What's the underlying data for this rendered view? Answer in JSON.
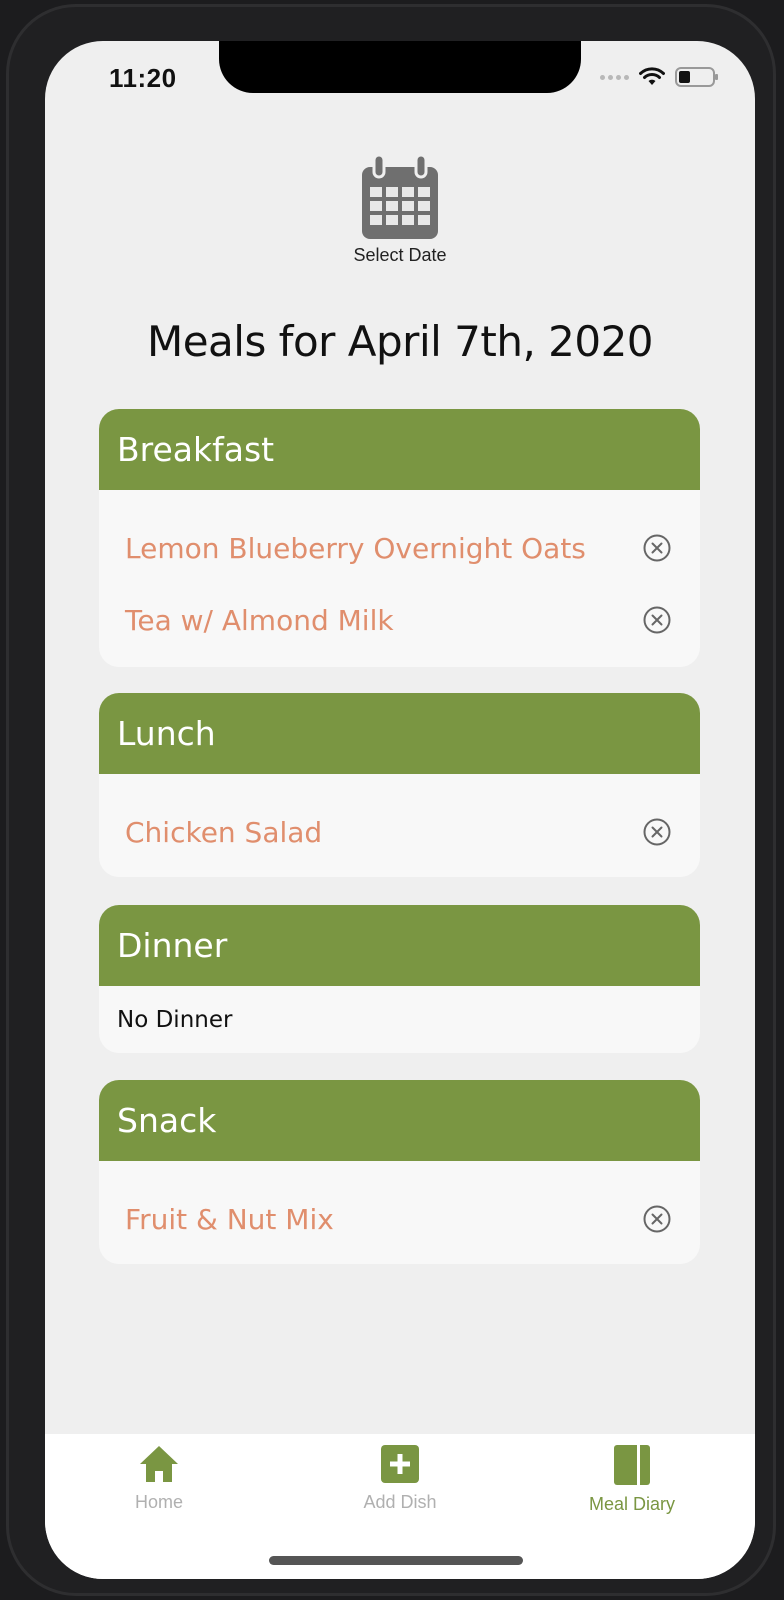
{
  "colors": {
    "accent": "#7a9642",
    "dish_text": "#e08e6d",
    "tab_inactive": "#b0b0b0",
    "tab_active": "#7a9642"
  },
  "status_bar": {
    "time": "11:20"
  },
  "date_picker": {
    "icon": "calendar-icon",
    "label": "Select Date"
  },
  "page_title": "Meals for April 7th, 2020",
  "meals": [
    {
      "title": "Breakfast",
      "dishes": [
        "Lemon Blueberry Overnight Oats",
        "Tea w/ Almond Milk"
      ]
    },
    {
      "title": "Lunch",
      "dishes": [
        "Chicken Salad"
      ]
    },
    {
      "title": "Dinner",
      "empty_text": "No Dinner"
    },
    {
      "title": "Snack",
      "dishes": [
        "Fruit & Nut Mix"
      ]
    }
  ],
  "tab_bar": {
    "tabs": [
      {
        "label": "Home",
        "icon": "home-icon",
        "active": false
      },
      {
        "label": "Add Dish",
        "icon": "add-square-icon",
        "active": false
      },
      {
        "label": "Meal Diary",
        "icon": "journal-icon",
        "active": true
      }
    ]
  }
}
